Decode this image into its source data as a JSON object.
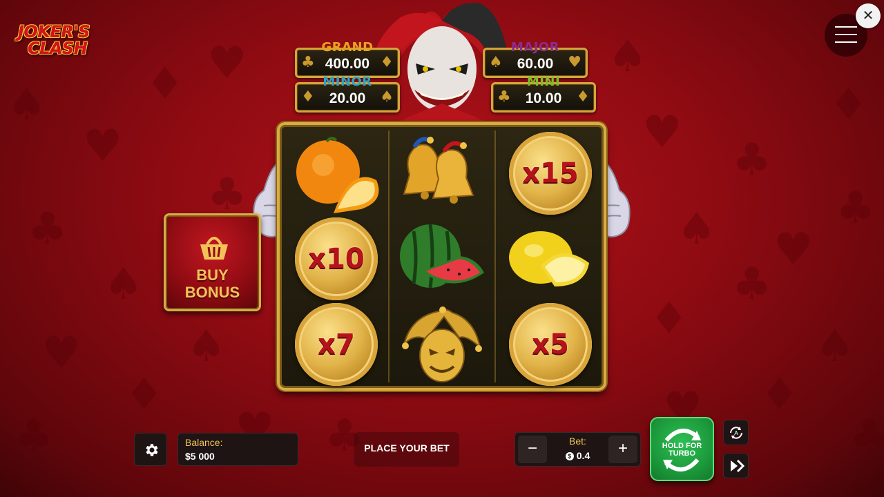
{
  "logo": {
    "line1": "JOKER'S",
    "line2": "CLASH"
  },
  "header": {
    "close_icon": "close-icon",
    "menu_icon": "hamburger-icon"
  },
  "jackpots": [
    {
      "name": "GRAND",
      "value": "400.00",
      "color": "#e9a21d"
    },
    {
      "name": "MAJOR",
      "value": "60.00",
      "color": "#8a2c8f"
    },
    {
      "name": "MINOR",
      "value": "20.00",
      "color": "#2aa6c7"
    },
    {
      "name": "MINI",
      "value": "10.00",
      "color": "#7ac12a"
    }
  ],
  "reels": {
    "columns": [
      [
        "orange",
        "x10",
        "x7"
      ],
      [
        "bells",
        "watermelon",
        "golden-jester-mask"
      ],
      [
        "x15",
        "lemon",
        "x5"
      ]
    ],
    "coin_labels": {
      "c0r1": "x10",
      "c0r2": "x7",
      "c2r0": "x15",
      "c2r2": "x5"
    }
  },
  "buy_bonus": {
    "line1": "BUY",
    "line2": "BONUS",
    "icon": "basket-icon"
  },
  "bottom_bar": {
    "settings_icon": "gear-icon",
    "balance_label": "Balance:",
    "balance_value": "$5 000",
    "place_bet": "PLACE YOUR BET",
    "bet_label": "Bet:",
    "bet_value": "0.4",
    "bet_currency_icon": "$",
    "minus": "−",
    "plus": "+",
    "spin_label_1": "HOLD FOR",
    "spin_label_2": "TURBO",
    "autoplay_icon": "autoplay-icon",
    "skip_icon": "fast-forward-icon"
  },
  "colors": {
    "accent_gold": "#d9ad44",
    "spin_green": "#1c9a3c",
    "background_red": "#8e0b12"
  }
}
